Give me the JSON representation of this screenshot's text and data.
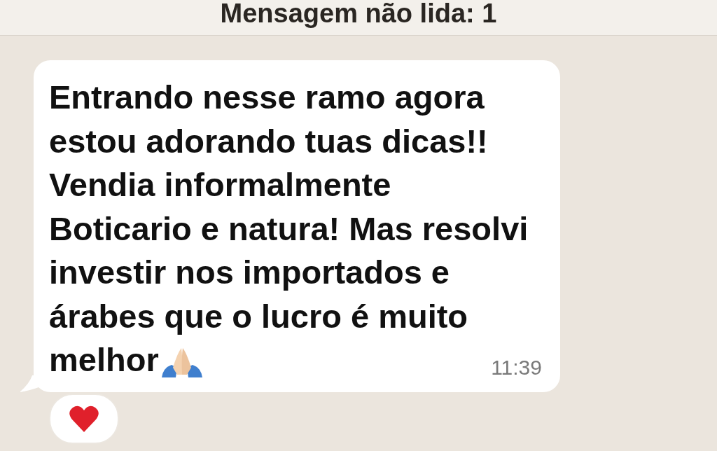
{
  "banner": {
    "text": "Mensagem não lida: 1"
  },
  "message": {
    "lines": [
      "Entrando nesse ramo agora",
      "estou adorando tuas dicas!!",
      "Vendia informalmente",
      "Boticario e natura! Mas resolvi",
      "investir nos importados e",
      "árabes que o lucro é muito",
      "melhor"
    ],
    "time": "11:39",
    "reactions": [
      {
        "kind": "heart"
      }
    ]
  }
}
